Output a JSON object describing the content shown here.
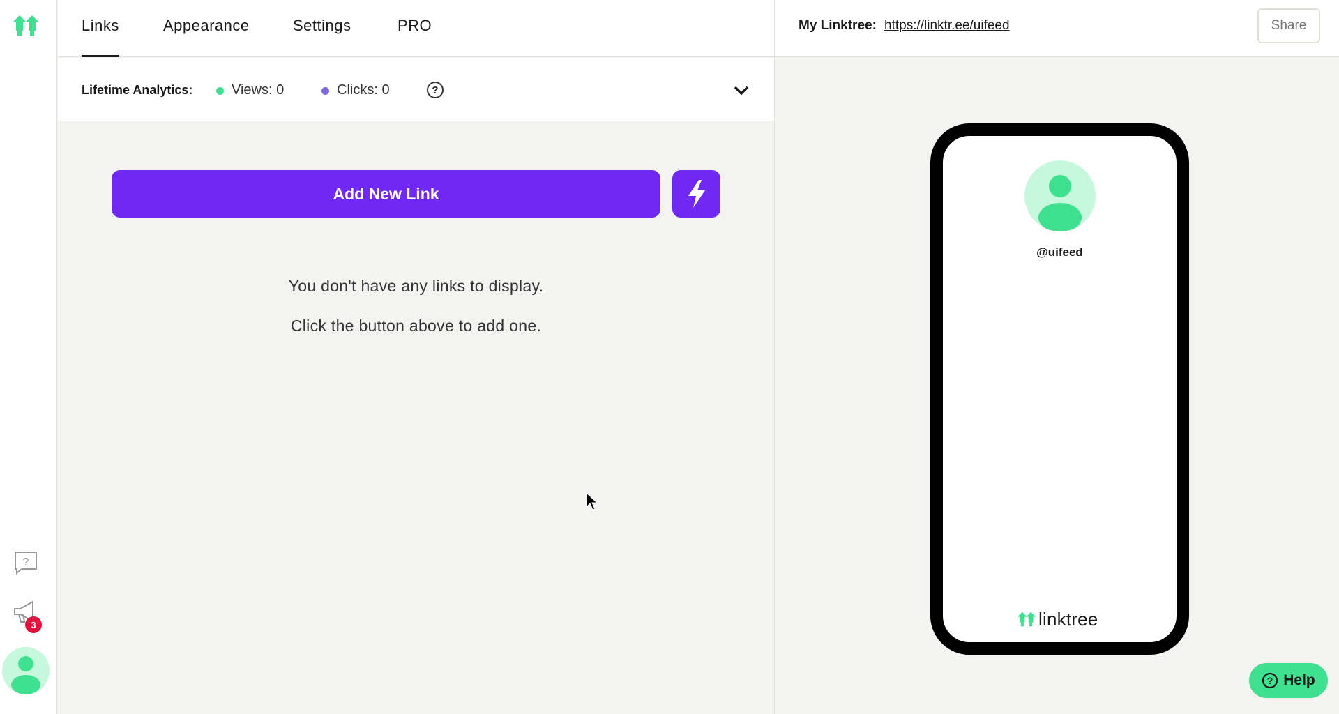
{
  "colors": {
    "accent": "#7028f4",
    "brand_green": "#3fe08f",
    "views_dot": "#3fe08f",
    "clicks_dot": "#7b65e0",
    "badge": "#e0143c",
    "avatar_bg": "#c7f7dd"
  },
  "sidebar": {
    "icons": [
      "linktree-logo-icon",
      "help-bubble-icon",
      "megaphone-icon",
      "avatar-icon"
    ],
    "notifications_count": "3"
  },
  "nav": {
    "tabs": [
      {
        "label": "Links",
        "active": true
      },
      {
        "label": "Appearance"
      },
      {
        "label": "Settings"
      },
      {
        "label": "PRO"
      }
    ]
  },
  "analytics": {
    "label": "Lifetime Analytics:",
    "views": "Views: 0",
    "clicks": "Clicks: 0",
    "help": "?"
  },
  "editor": {
    "add_button": "Add New Link",
    "empty_line1": "You don't have any links to display.",
    "empty_line2": "Click the button above to add one."
  },
  "preview": {
    "label": "My Linktree:",
    "url": "https://linktr.ee/uifeed",
    "share": "Share",
    "handle": "@uifeed",
    "brand": "linktree"
  },
  "help_button": {
    "label": "Help"
  }
}
